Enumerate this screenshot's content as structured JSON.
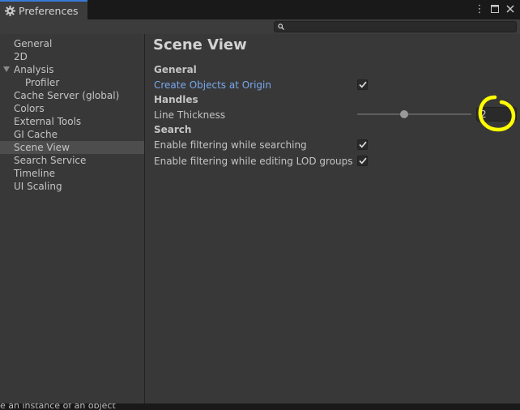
{
  "window": {
    "tab_title": "Preferences",
    "tab_icon": "gear-icon",
    "controls": [
      "more-icon",
      "maximize-icon",
      "close-icon"
    ]
  },
  "search": {
    "value": "",
    "placeholder": ""
  },
  "sidebar": {
    "items": [
      {
        "label": "General"
      },
      {
        "label": "2D"
      },
      {
        "label": "Analysis"
      },
      {
        "label": "Profiler"
      },
      {
        "label": "Cache Server (global)"
      },
      {
        "label": "Colors"
      },
      {
        "label": "External Tools"
      },
      {
        "label": "GI Cache"
      },
      {
        "label": "Scene View"
      },
      {
        "label": "Search Service"
      },
      {
        "label": "Timeline"
      },
      {
        "label": "UI Scaling"
      }
    ],
    "selected": "Scene View"
  },
  "main": {
    "title": "Scene View",
    "sections": {
      "general": {
        "heading": "General",
        "create_objects_label": "Create Objects at Origin",
        "create_objects_checked": true
      },
      "handles": {
        "heading": "Handles",
        "line_thickness_label": "Line Thickness",
        "line_thickness_value": "2",
        "line_thickness_fraction": 0.4
      },
      "search": {
        "heading": "Search",
        "filter_searching_label": "Enable filtering while searching",
        "filter_searching_checked": true,
        "filter_lod_label": "Enable filtering while editing LOD groups",
        "filter_lod_checked": true
      }
    }
  },
  "status": {
    "text": "e an instance of an object"
  },
  "colors": {
    "accent": "#3a7ad6",
    "highlight_label": "#79a8ee",
    "annotation": "#ffff00"
  }
}
